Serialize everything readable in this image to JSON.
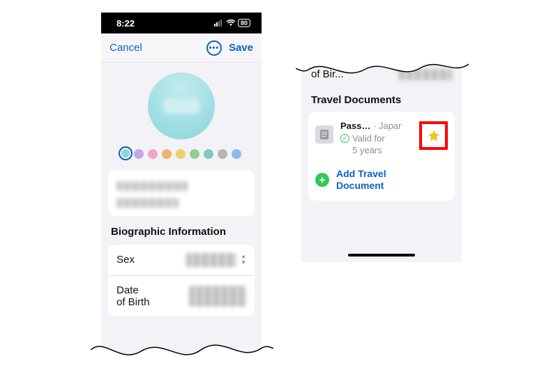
{
  "statusbar": {
    "time": "8:22",
    "batteryPercent": "80"
  },
  "toolbar": {
    "cancel": "Cancel",
    "save": "Save"
  },
  "swatches": [
    {
      "name": "teal",
      "hex": "#8fd6da",
      "selected": true
    },
    {
      "name": "purple",
      "hex": "#c6a6e8",
      "selected": false
    },
    {
      "name": "pink",
      "hex": "#f2a7c4",
      "selected": false
    },
    {
      "name": "orange",
      "hex": "#f1b46b",
      "selected": false
    },
    {
      "name": "yellow",
      "hex": "#e9d36a",
      "selected": false
    },
    {
      "name": "green",
      "hex": "#90cf95",
      "selected": false
    },
    {
      "name": "teal2",
      "hex": "#7fc9c2",
      "selected": false
    },
    {
      "name": "grey",
      "hex": "#b4b4b9",
      "selected": false
    },
    {
      "name": "blue",
      "hex": "#8fb9ee",
      "selected": false
    }
  ],
  "biographic": {
    "title": "Biographic Information",
    "rows": {
      "sex": "Sex",
      "dob1": "Date",
      "dob2": "of Birth"
    }
  },
  "right": {
    "topLabel": "of Bir...",
    "sectionTitle": "Travel Documents",
    "doc": {
      "titleShort": "Pass…",
      "sep": "·",
      "country": "Japar",
      "valid1": "Valid for",
      "valid2": "5 years"
    },
    "add": {
      "line1": "Add Travel",
      "line2": "Document"
    }
  }
}
